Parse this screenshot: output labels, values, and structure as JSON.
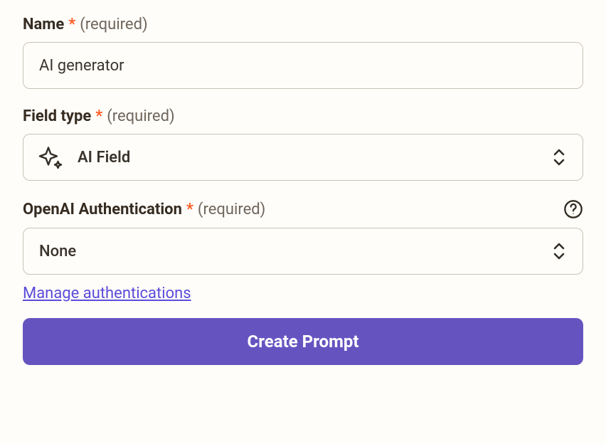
{
  "name_field": {
    "label": "Name",
    "hint": "(required)",
    "value": "AI generator"
  },
  "field_type": {
    "label": "Field type",
    "hint": "(required)",
    "value": "AI Field"
  },
  "auth": {
    "label": "OpenAI Authentication",
    "hint": "(required)",
    "value": "None",
    "manage_link": "Manage authentications"
  },
  "submit": {
    "label": "Create Prompt"
  },
  "colors": {
    "accent": "#6554c0",
    "required": "#ff5c22",
    "link": "#5b4cdb"
  }
}
